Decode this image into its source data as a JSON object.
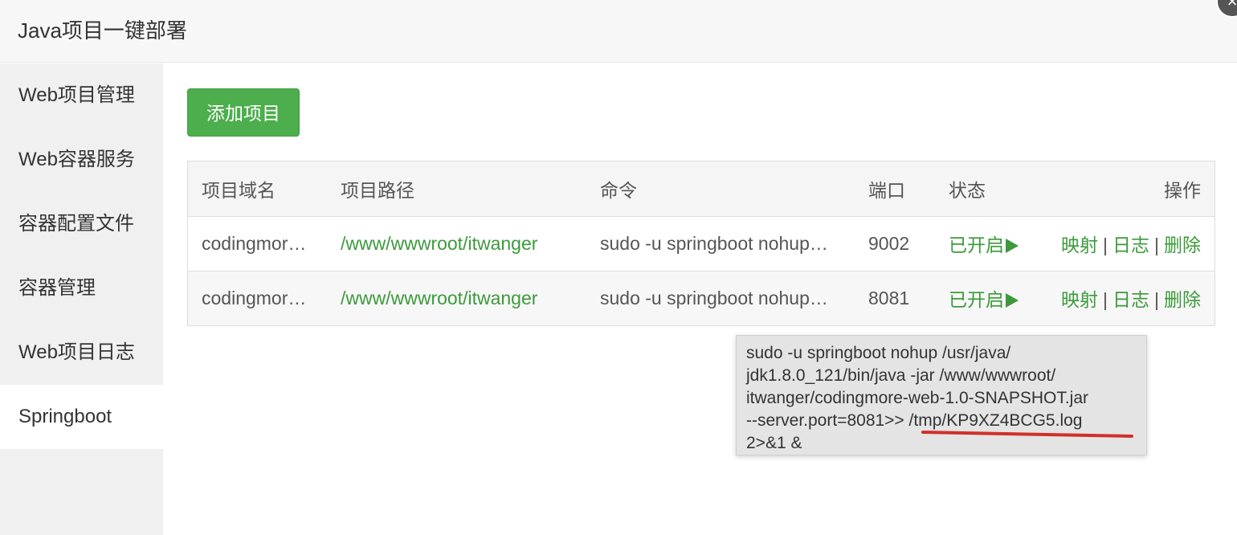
{
  "window": {
    "title": "Java项目一键部署",
    "close_glyph": "×"
  },
  "sidebar": {
    "items": [
      {
        "label": "Web项目管理",
        "active": false
      },
      {
        "label": "Web容器服务",
        "active": false
      },
      {
        "label": "容器配置文件",
        "active": false
      },
      {
        "label": "容器管理",
        "active": false
      },
      {
        "label": "Web项目日志",
        "active": false
      },
      {
        "label": "Springboot",
        "active": true
      }
    ]
  },
  "toolbar": {
    "add_label": "添加项目"
  },
  "table": {
    "headers": [
      "项目域名",
      "项目路径",
      "命令",
      "端口",
      "状态",
      "操作"
    ],
    "rows": [
      {
        "domain": "codingmor…",
        "path": "/www/wwwroot/itwanger",
        "command": "sudo -u springboot nohup…",
        "port": "9002",
        "status": "已开启",
        "ops": [
          "映射",
          "日志",
          "删除"
        ]
      },
      {
        "domain": "codingmor…",
        "path": "/www/wwwroot/itwanger",
        "command": "sudo -u springboot nohup…",
        "port": "8081",
        "status": "已开启",
        "ops": [
          "映射",
          "日志",
          "删除"
        ]
      }
    ],
    "op_separator": "|"
  },
  "tooltip": {
    "lines": [
      "sudo -u springboot nohup /usr/java/",
      "jdk1.8.0_121/bin/java -jar /www/wwwroot/",
      "itwanger/codingmore-web-1.0-SNAPSHOT.jar",
      "--server.port=8081>> /tmp/KP9XZ4BCG5.log",
      "2>&1 &"
    ]
  },
  "colors": {
    "accent_green": "#4cae4c",
    "link_green": "#3c9a3c",
    "annotation_red": "#d0302a"
  },
  "icons": {
    "status_icon": "play-icon",
    "close_icon": "close-icon"
  }
}
